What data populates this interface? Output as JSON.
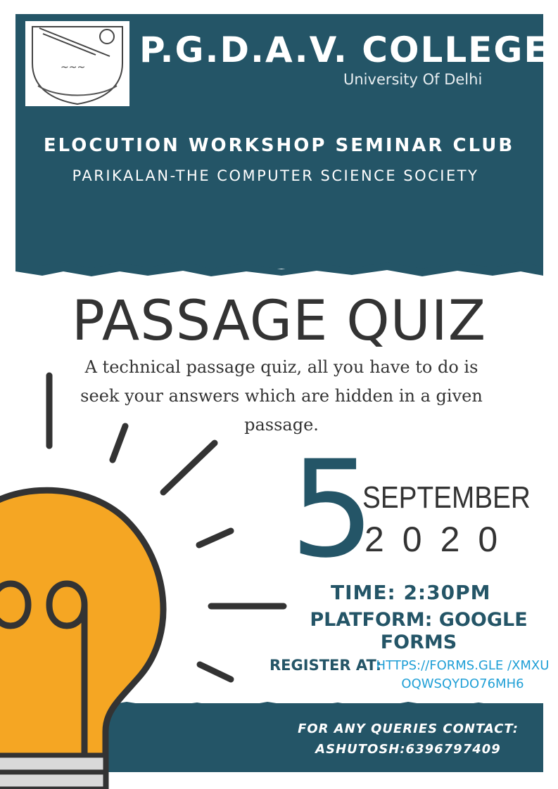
{
  "header": {
    "college_name": "P.G.D.A.V. COLLEGE",
    "university": "University Of Delhi",
    "club": "ELOCUTION WORKSHOP SEMINAR CLUB",
    "society": "PARIKALAN-THE COMPUTER SCIENCE SOCIETY"
  },
  "event": {
    "title": "PASSAGE QUIZ",
    "description": "A technical passage quiz, all you have to do is seek your answers which are hidden in a given passage.",
    "day": "5",
    "month": "SEPTEMBER",
    "year": "2020",
    "time": "TIME: 2:30PM",
    "platform": "PLATFORM: GOOGLE FORMS",
    "register_label": "REGISTER AT:",
    "register_link": "HTTPS://FORMS.GLE /XMXUOQWSQYDO76MH6"
  },
  "contact": {
    "line1": "FOR ANY QUERIES CONTACT:",
    "line2": "ASHUTOSH:6396797409"
  },
  "colors": {
    "brand": "#245567",
    "bulb": "#f5a623",
    "link": "#1f9fd6",
    "text": "#333333"
  }
}
